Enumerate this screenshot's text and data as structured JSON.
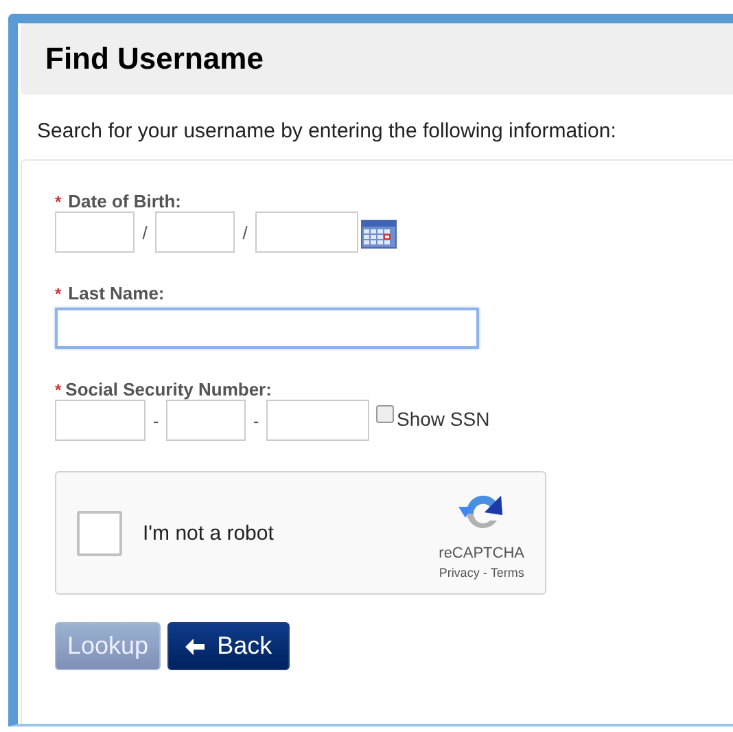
{
  "title": "Find Username",
  "intro": "Search for your username by entering the following information:",
  "fields": [
    {
      "kind": "date",
      "label": "Date of Birth:",
      "required_mark": "*",
      "separators": [
        "/",
        "/"
      ]
    },
    {
      "kind": "text",
      "label": "Last Name:",
      "required_mark": "*",
      "focused": true
    },
    {
      "kind": "ssn",
      "label": "Social Security Number:",
      "required_mark": "*",
      "separators": [
        "-",
        "-"
      ],
      "toggle": {
        "label": "Show SSN",
        "checked": false
      }
    }
  ],
  "captcha": {
    "label": "I'm not a robot",
    "checked": false,
    "brand": "reCAPTCHA",
    "links": [
      "Privacy",
      "Terms"
    ],
    "link_separator": " - "
  },
  "buttons": [
    {
      "kind": "primary",
      "label": "Lookup",
      "disabled": true
    },
    {
      "kind": "back",
      "label": "Back",
      "disabled": false
    }
  ]
}
